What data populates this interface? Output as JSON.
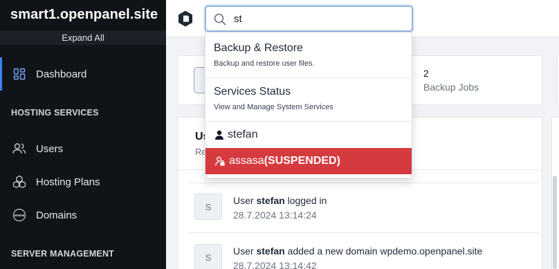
{
  "sidebar": {
    "brand": "smart1.openpanel.site",
    "expand_label": "Expand All",
    "dashboard_label": "Dashboard",
    "section_hosting": "HOSTING SERVICES",
    "users_label": "Users",
    "plans_label": "Hosting Plans",
    "domains_label": "Domains",
    "section_server": "SERVER MANAGEMENT"
  },
  "search": {
    "value": "st"
  },
  "dropdown": {
    "items": [
      {
        "title": "Backup & Restore",
        "desc": "Backup and restore user files."
      },
      {
        "title": "Services Status",
        "desc": "View and Manage System Services"
      }
    ],
    "users": [
      {
        "name": "stefan"
      },
      {
        "name": "assasa",
        "suffix": "(SUSPENDED)"
      }
    ]
  },
  "stats": {
    "backup_count": "2",
    "backup_label": "Backup Jobs"
  },
  "activity": {
    "title": "Us",
    "subtitle": "Re",
    "rows": [
      {
        "avatar": "S",
        "prefix": "User ",
        "user": "stefan",
        "action": " logged in",
        "time": "28.7.2024 13:14:24"
      },
      {
        "avatar": "S",
        "prefix": "User ",
        "user": "stefan",
        "action": " added a new domain wpdemo.openpanel.site",
        "time": "28.7.2024 13:14:42"
      }
    ]
  },
  "colors": {
    "sidebar_bg": "#101418",
    "active_accent": "#3b82f6",
    "suspended_bg": "#d53a3f"
  }
}
